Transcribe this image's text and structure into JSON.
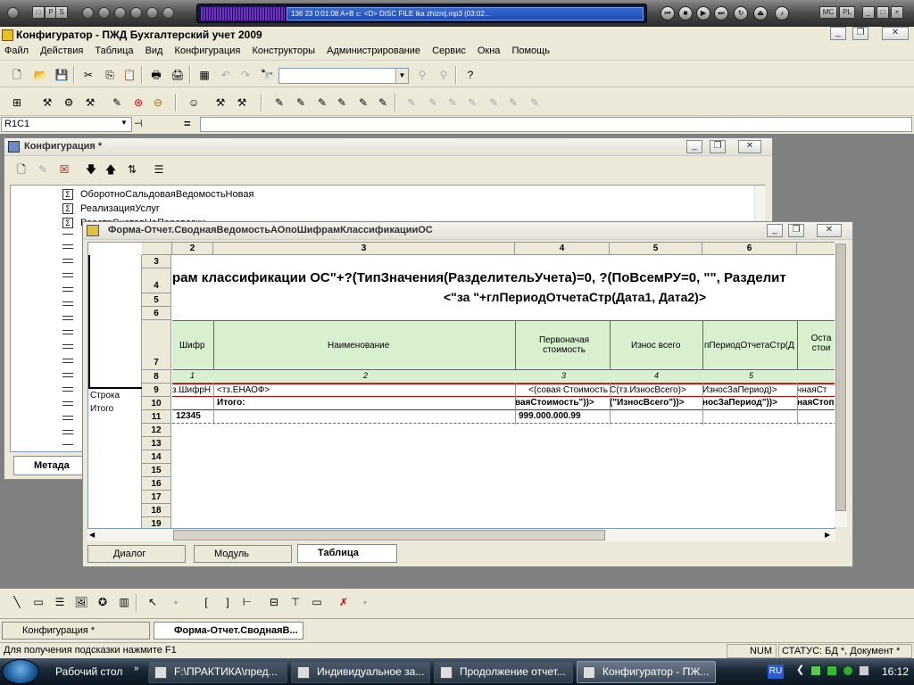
{
  "player": {
    "track": "136     23      0:01:08     A+B  ⊏  <D>    DISC   FILE   ika zhiznij.mp3  (03:02..."
  },
  "app": {
    "title": "Конфигуратор - ПЖД Бухгалтерский учет 2009"
  },
  "menu": [
    "Файл",
    "Действия",
    "Таблица",
    "Вид",
    "Конфигурация",
    "Конструкторы",
    "Администрирование",
    "Сервис",
    "Окна",
    "Помощь"
  ],
  "formula": {
    "cell": "R1C1",
    "eq": "="
  },
  "config_window": {
    "title": "Конфигурация *",
    "items": [
      "ОборотноСальдоваяВедомостьНовая",
      "РеализацияУслуг",
      "РеестрСчетовНаПеревозки"
    ],
    "tab_label": "Метада"
  },
  "form_window": {
    "title": "Форма-Отчет.СводнаяВедомостьАОпоШифрамКлассификацииОС",
    "col_headers": [
      "2",
      "3",
      "4",
      "5",
      "6"
    ],
    "row_numbers": [
      "3",
      "4",
      "5",
      "6",
      "7",
      "8",
      "9",
      "10",
      "11",
      "12",
      "13",
      "14",
      "15",
      "16",
      "17",
      "18",
      "19"
    ],
    "row_labels": {
      "stroka": "Строка",
      "itogo": "Итого"
    },
    "heading1": "рам классификации ОС\"+?(ТипЗначения(РазделительУчета)=0, ?(ПоВсемРУ=0, \"\", Разделит",
    "heading2": "<\"за \"+глПериодОтчетаСтр(Дата1, Дата2)>",
    "headers": {
      "shifr": "Шифр",
      "name": "Наименование",
      "cost": "Первоначая стоимость",
      "wear": "Износ всего",
      "period": "пПериодОтчетаСтр(Д",
      "rest": "Оста стои"
    },
    "numbering": [
      "1",
      "2",
      "3",
      "4",
      "5"
    ],
    "row9": {
      "c2": "з.ШифрН",
      "c3": "<тз.ЕНАОФ>",
      "c4": "совая Стоимость)>",
      "c5": "С(тз.ИзносВсего)>",
      "c6": "ИзносЗаПериод)>",
      "c7": "чнаяСт"
    },
    "row10": {
      "c3": "Итого:",
      "c4": "ваяСтоимость\"))>",
      "c5": "(\"ИзносВсего\"))>",
      "c6": "носЗаПериод\"))>",
      "c7": "наяСтоп"
    },
    "row11": {
      "c2": "12345",
      "c4": "999.000.000.99"
    },
    "tabs": [
      "Диалог",
      "Модуль",
      "Таблица"
    ]
  },
  "window_tabs": [
    "Конфигурация *",
    "Форма-Отчет.СводнаяВ..."
  ],
  "status": {
    "hint": "Для получения подсказки нажмите F1",
    "num": "NUM",
    "state": "СТАТУС: БД *, Документ *"
  },
  "taskbar": {
    "items": [
      "Рабочий стол",
      "F:\\ПРАКТИКА\\пред...",
      "Индивидуальное за...",
      "Продолжение отчет...",
      "Конфигуратор - ПЖ..."
    ],
    "lang": "RU",
    "time": "16:12"
  }
}
